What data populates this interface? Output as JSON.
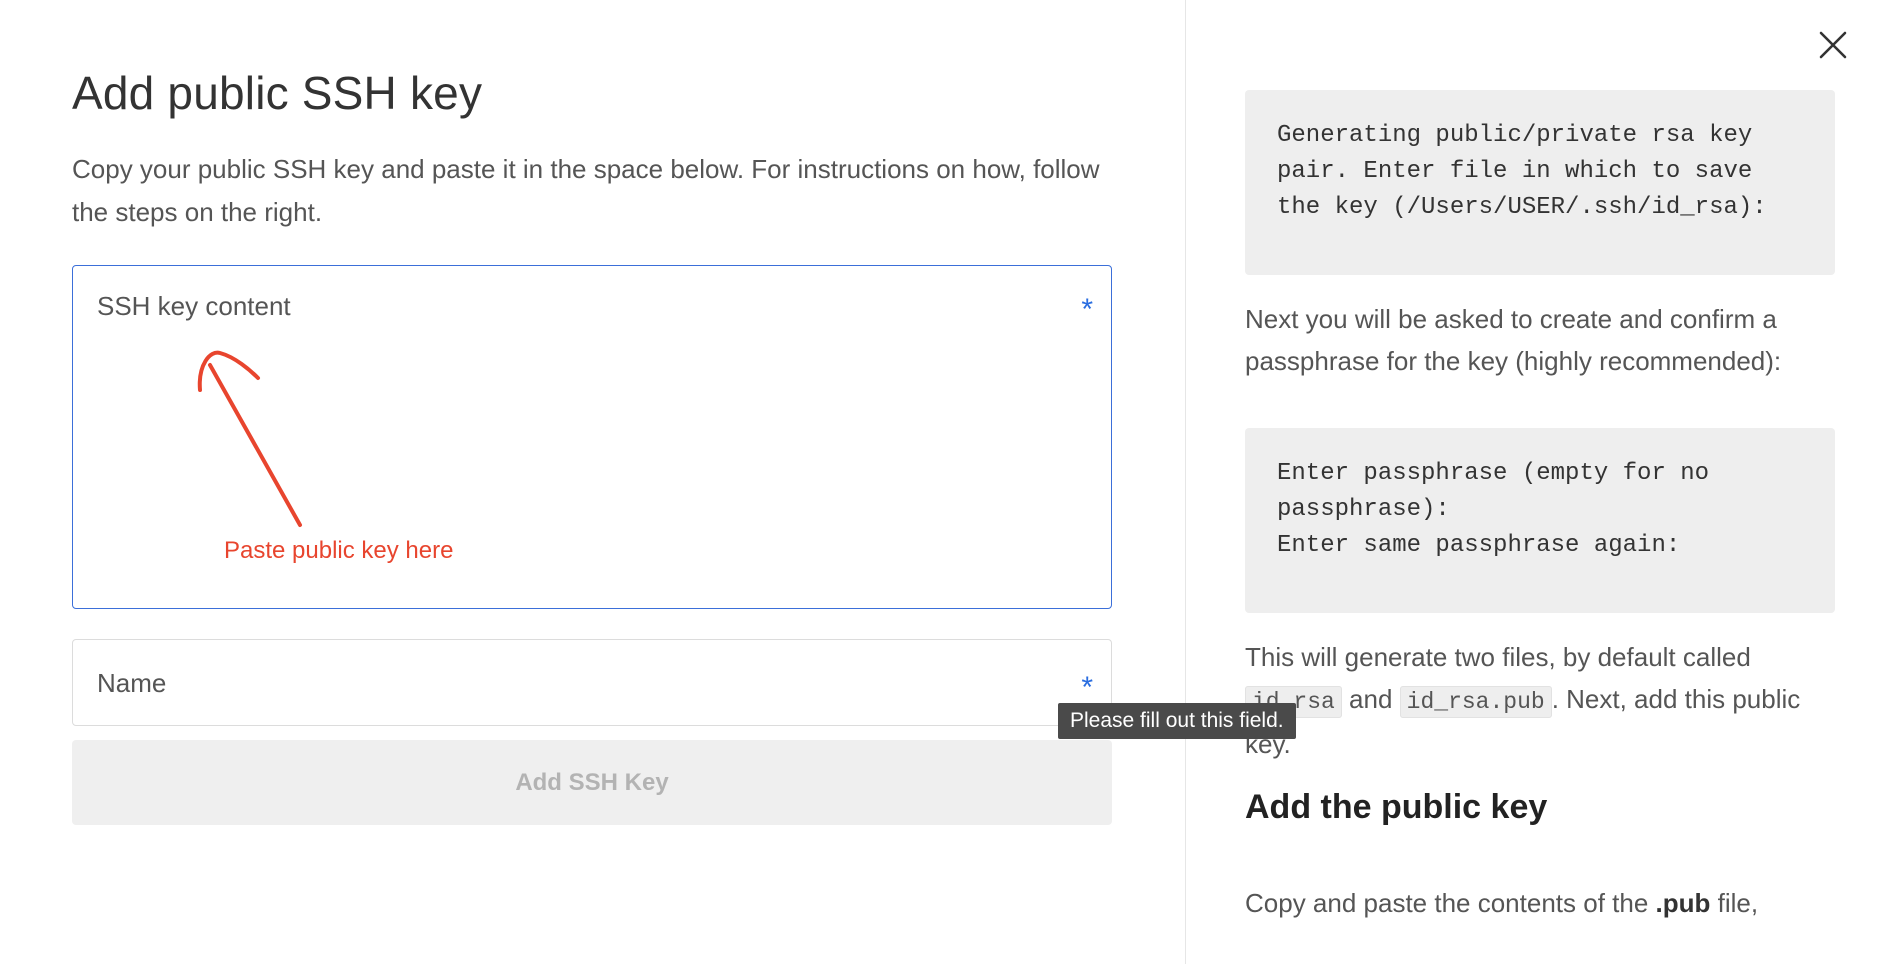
{
  "page": {
    "title": "Add public SSH key",
    "description": "Copy your public SSH key and paste it in the space below. For instructions on how, follow the steps on the right."
  },
  "form": {
    "ssh_key": {
      "label": "SSH key content",
      "required_marker": "*",
      "value": ""
    },
    "name": {
      "label": "Name",
      "required_marker": "*",
      "value": ""
    },
    "submit_label": "Add SSH Key",
    "validation_tooltip": "Please fill out this field."
  },
  "annotation": {
    "text": "Paste public key here",
    "color": "#e8452e"
  },
  "close_icon": "close-icon",
  "instructions": {
    "code_block_1": "Generating public/private rsa key pair. Enter file in which to save the key (/Users/USER/.ssh/id_rsa):",
    "para_1": "Next you will be asked to create and confirm a passphrase for the key (highly recommended):",
    "code_block_2": "Enter passphrase (empty for no passphrase):\nEnter same passphrase again:",
    "para_2": {
      "before": "This will generate two files, by default called ",
      "code_1": "id_rsa",
      "middle": " and ",
      "code_2": "id_rsa.pub",
      "after": ". Next, add this public key."
    },
    "subheading": "Add the public key",
    "para_3": {
      "before": "Copy and paste the contents of the ",
      "bold": ".pub",
      "after": " file,"
    }
  },
  "colors": {
    "focus_border": "#3b6fd9",
    "required_marker": "#2a6de0",
    "annotation": "#e8452e",
    "tooltip_bg": "#4a4a4a",
    "code_bg": "#eeeeee"
  }
}
